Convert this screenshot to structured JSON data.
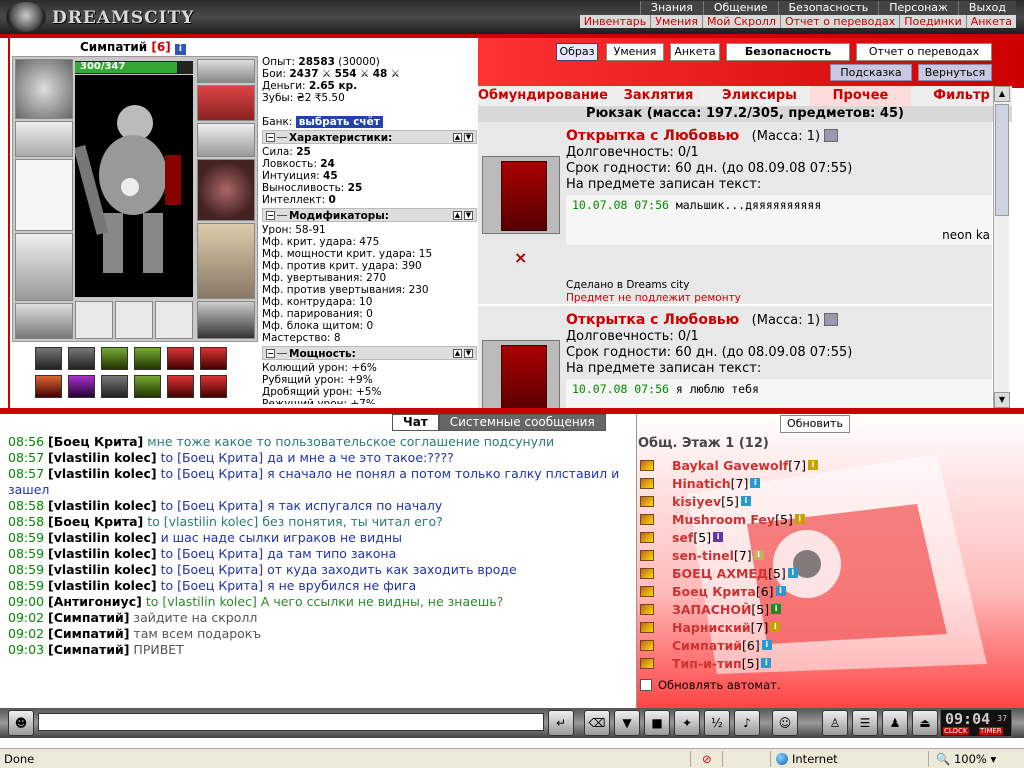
{
  "app": {
    "logo": "DREAMSCITY"
  },
  "top_menu": [
    "Знания",
    "Общение",
    "Безопасность",
    "Персонаж",
    "Выход"
  ],
  "sub_menu": [
    "Инвентарь",
    "Умения",
    "Мой Скролл",
    "Отчет о переводах",
    "Поединки",
    "Анкета"
  ],
  "character": {
    "name": "Симпатий",
    "level": "[6]",
    "hp": "300/347",
    "hp_fraction": 0.865
  },
  "stats": {
    "exp_label": "Опыт:",
    "exp": "28583",
    "exp_next": "(30000)",
    "battles_label": "Бои:",
    "battles_won": "2437",
    "battles_lost": "554",
    "battles_draw": "48",
    "money_label": "Деньги:",
    "money": "2.65 кр.",
    "teeth_label": "Зубы:",
    "teeth": "₴2 ₹5.50",
    "bank_label": "Банк:",
    "bank_button": "выбрать счёт"
  },
  "characteristics": {
    "header": "Характеристики:",
    "rows": [
      {
        "label": "Сила:",
        "value": "25"
      },
      {
        "label": "Ловкость:",
        "value": "24"
      },
      {
        "label": "Интуиция:",
        "value": "45"
      },
      {
        "label": "Выносливость:",
        "value": "25"
      },
      {
        "label": "Интеллект:",
        "value": "0"
      }
    ]
  },
  "modifiers": {
    "header": "Модификаторы:",
    "rows": [
      "Урон: 58-91",
      "Мф. крит. удара: 475",
      "Мф. мощности крит. удара: 15",
      "Мф. против крит. удара: 390",
      "Мф. увертывания: 270",
      "Мф. против увертывания: 230",
      "Мф. контрудара: 10",
      "Мф. парирования: 0",
      "Мф. блока щитом: 0",
      "Мастерство: 8"
    ]
  },
  "power": {
    "header": "Мощность:",
    "rows": [
      "Колющий урон: +6%",
      "Рубящий урон: +9%",
      "Дробящий урон: +5%",
      "Режущий урон: +7%"
    ]
  },
  "buttons": {
    "obraz": "Образ",
    "umeniya": "Умения",
    "anketa": "Анкета",
    "bezopasnost": "Безопасность",
    "otchet": "Отчет о переводах",
    "podskazka": "Подсказка",
    "vernutsya": "Вернуться"
  },
  "inventory": {
    "tabs": [
      "Обмундирование",
      "Заклятия",
      "Эликсиры",
      "Прочее",
      "Фильтр"
    ],
    "active_tab": "Прочее",
    "rucksack": "Рюкзак (масса: 197.2/305, предметов: 45)",
    "items": [
      {
        "title": "Открытка с Любовью",
        "mass": "(Масса: 1)",
        "durability": "Долговечность: 0/1",
        "expiry": "Срок годности: 60 дн. (до 08.09.08 07:55)",
        "text_label": "На предмете записан текст:",
        "note_date": "10.07.08 07:56",
        "note_text": "мальшик...дяяяяяяяяяя",
        "signature": "neon ka",
        "made": "Сделано в Dreams city",
        "no_repair": "Предмет не подлежит ремонту",
        "delete_icon": "×"
      },
      {
        "title": "Открытка с Любовью",
        "mass": "(Масса: 1)",
        "durability": "Долговечность: 0/1",
        "expiry": "Срок годности: 60 дн. (до 08.09.08 07:55)",
        "text_label": "На предмете записан текст:",
        "note_date": "10.07.08 07:56",
        "note_text": "я люблю тебя"
      }
    ]
  },
  "chat": {
    "tabs": [
      "Чат",
      "Системные сообщения"
    ],
    "lines": [
      {
        "time": "08:56",
        "name": "[Боец Крита]",
        "to": "",
        "msg": "мне тоже какое то пользовательское соглашение подсунули",
        "cls": "m1"
      },
      {
        "time": "08:57",
        "name": "[vlastilin kolec]",
        "to": "to [Боец Крита]",
        "msg": "да и мне а че это такое:????",
        "cls": "m2"
      },
      {
        "time": "08:57",
        "name": "[vlastilin kolec]",
        "to": "to [Боец Крита]",
        "msg": "я сначало не понял а потом только галку плставил и зашел",
        "cls": "m2"
      },
      {
        "time": "08:58",
        "name": "[vlastilin kolec]",
        "to": "to [Боец Крита]",
        "msg": "я так испугался по началу",
        "cls": "m2"
      },
      {
        "time": "08:58",
        "name": "[Боец Крита]",
        "to": "to [vlastilin kolec]",
        "msg": "без понятия, ты читал его?",
        "cls": "m1"
      },
      {
        "time": "08:59",
        "name": "[vlastilin kolec]",
        "to": "",
        "msg": "и шас наде сылки играков не видны",
        "cls": "m2"
      },
      {
        "time": "08:59",
        "name": "[vlastilin kolec]",
        "to": "to [Боец Крита]",
        "msg": "да там типо закона",
        "cls": "m2"
      },
      {
        "time": "08:59",
        "name": "[vlastilin kolec]",
        "to": "to [Боец Крита]",
        "msg": "от куда заходить как заходить вроде",
        "cls": "m2"
      },
      {
        "time": "08:59",
        "name": "[vlastilin kolec]",
        "to": "to [Боец Крита]",
        "msg": "я не врубился не фига",
        "cls": "m2"
      },
      {
        "time": "09:00",
        "name": "[Антигониус]",
        "to": "to [vlastilin kolec]",
        "msg": "А чего ссылки не видны, не знаешь?",
        "cls": "m3"
      },
      {
        "time": "09:02",
        "name": "[Симпатий]",
        "to": "",
        "msg": "зайдите на скролл",
        "cls": "m4"
      },
      {
        "time": "09:02",
        "name": "[Симпатий]",
        "to": "",
        "msg": "там всем подарокъ",
        "cls": "m4"
      },
      {
        "time": "09:03",
        "name": "[Симпатий]",
        "to": "",
        "msg": "ПРИВЕТ",
        "cls": "m4"
      }
    ]
  },
  "online": {
    "refresh": "Обновить",
    "floor": "Общ. Этаж 1 (12)",
    "users": [
      {
        "name": "Baykal Gavewolf",
        "level": "[7]",
        "color": "#c8a000"
      },
      {
        "name": "Hinatich",
        "level": "[7]",
        "color": "#2a9acc"
      },
      {
        "name": "kisiyev",
        "level": "[5]",
        "color": "#2a9acc"
      },
      {
        "name": "Mushroom Fey",
        "level": "[5]",
        "color": "#c8a000"
      },
      {
        "name": "sef",
        "level": "[5]",
        "color": "#6633aa"
      },
      {
        "name": "sen-tinel",
        "level": "[7]",
        "color": "#c8b060"
      },
      {
        "name": "БОЕЦ АХМЕД",
        "level": "[5]",
        "color": "#2a9acc"
      },
      {
        "name": "Боец Крита",
        "level": "[6]",
        "color": "#2a9acc"
      },
      {
        "name": "ЗАПАСНОЙ",
        "level": "[5]",
        "color": "#228822"
      },
      {
        "name": "Нарниский",
        "level": "[7]",
        "color": "#c8a000"
      },
      {
        "name": "Симпатий",
        "level": "[6]",
        "color": "#2a9acc"
      },
      {
        "name": "Тип-и-тип",
        "level": "[5]",
        "color": "#2a9acc"
      }
    ],
    "auto_refresh": "Обновлять автомат."
  },
  "clock": {
    "time": "09:04",
    "seconds": "37",
    "clock_label": "CLOCK",
    "timer_label": "TIMER"
  },
  "status": {
    "left": "Done",
    "zone": "Internet",
    "zoom": "100%"
  }
}
